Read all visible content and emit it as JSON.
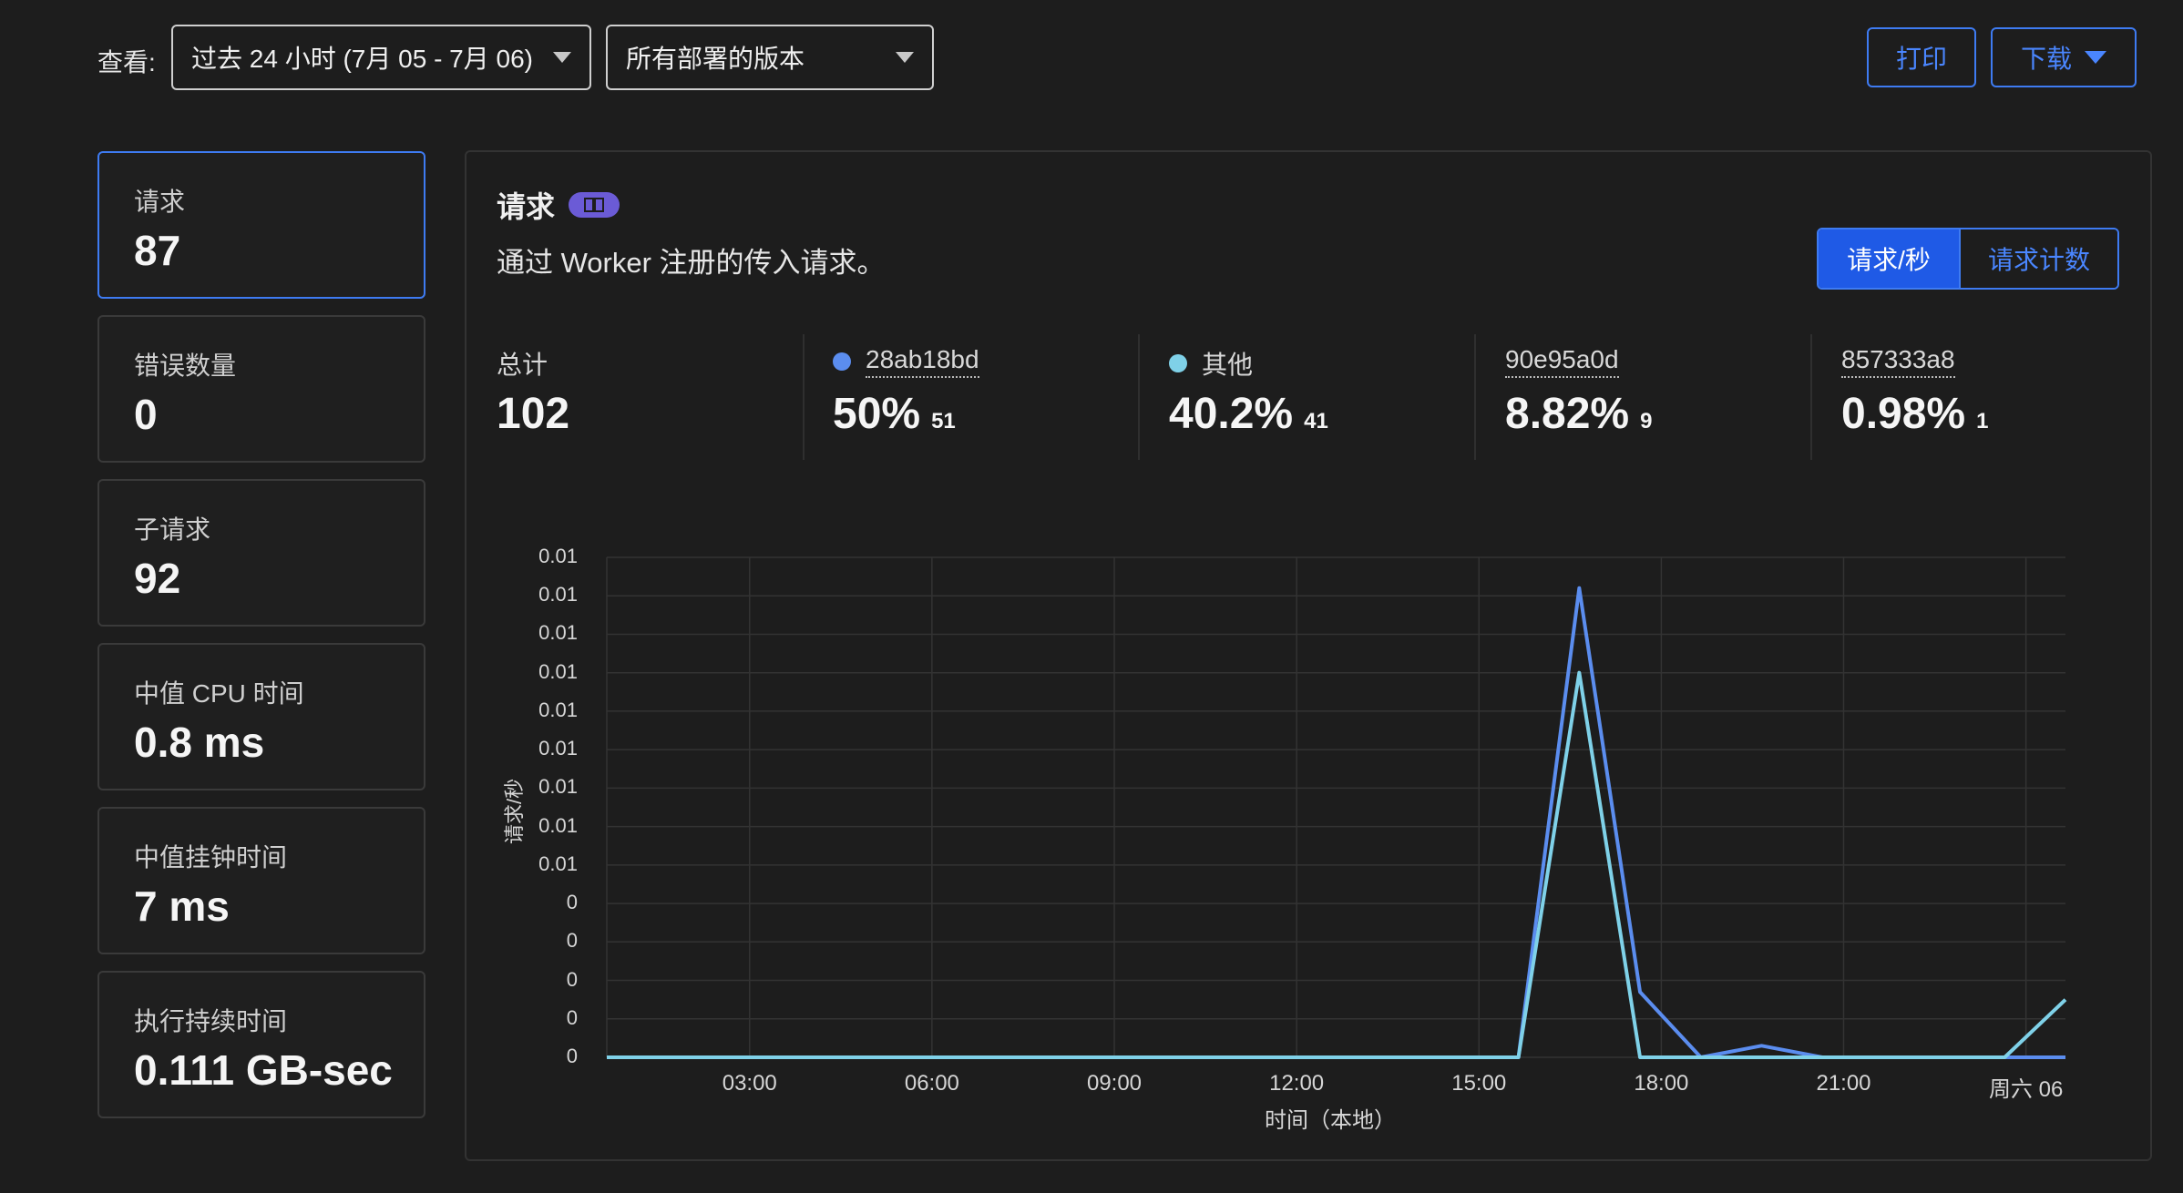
{
  "toolbar": {
    "view_label": "查看:",
    "time_range": "过去 24 小时 (7月 05 - 7月 06)",
    "versions": "所有部署的版本",
    "print": "打印",
    "download": "下载"
  },
  "metrics": [
    {
      "label": "请求",
      "value": "87"
    },
    {
      "label": "错误数量",
      "value": "0"
    },
    {
      "label": "子请求",
      "value": "92"
    },
    {
      "label": "中值 CPU 时间",
      "value": "0.8 ms"
    },
    {
      "label": "中值挂钟时间",
      "value": "7 ms"
    },
    {
      "label": "执行持续时间",
      "value": "0.111 GB-sec"
    }
  ],
  "panel": {
    "title": "请求",
    "description": "通过 Worker 注册的传入请求。",
    "toggle": {
      "per_second": "请求/秒",
      "count": "请求计数"
    },
    "stats": [
      {
        "label": "总计",
        "value": "102",
        "count": ""
      },
      {
        "label": "28ab18bd",
        "value": "50%",
        "count": "51",
        "color": "#5b8def"
      },
      {
        "label": "其他",
        "value": "40.2%",
        "count": "41",
        "color": "#7fd1e8"
      },
      {
        "label": "90e95a0d",
        "value": "8.82%",
        "count": "9"
      },
      {
        "label": "857333a8",
        "value": "0.98%",
        "count": "1"
      }
    ]
  },
  "chart_data": {
    "type": "line",
    "xlabel": "时间（本地）",
    "ylabel": "请求/秒",
    "x_tick_labels": [
      "03:00",
      "06:00",
      "09:00",
      "12:00",
      "15:00",
      "18:00",
      "21:00",
      "周六 06"
    ],
    "y_tick_labels": [
      "0.01",
      "0.01",
      "0.01",
      "0.01",
      "0.01",
      "0.01",
      "0.01",
      "0.01",
      "0.01",
      "0",
      "0",
      "0",
      "0",
      "0"
    ],
    "ylim": [
      0,
      0.013
    ],
    "x_hours": [
      1,
      2,
      3,
      4,
      5,
      6,
      7,
      8,
      9,
      10,
      11,
      12,
      13,
      14,
      15,
      16,
      17,
      18,
      19,
      20,
      21,
      22,
      23,
      24,
      25
    ],
    "series": [
      {
        "name": "28ab18bd",
        "color": "#5b8def",
        "values": [
          0,
          0,
          0,
          0,
          0,
          0,
          0,
          0,
          0,
          0,
          0,
          0,
          0,
          0,
          0,
          0,
          0.0122,
          0.0017,
          0,
          0.0003,
          0,
          0,
          0,
          0,
          0
        ]
      },
      {
        "name": "其他",
        "color": "#7fd1e8",
        "values": [
          0,
          0,
          0,
          0,
          0,
          0,
          0,
          0,
          0,
          0,
          0,
          0,
          0,
          0,
          0,
          0,
          0.01,
          0,
          0,
          0,
          0,
          0,
          0,
          0,
          0.0015
        ]
      }
    ],
    "grid": true
  }
}
